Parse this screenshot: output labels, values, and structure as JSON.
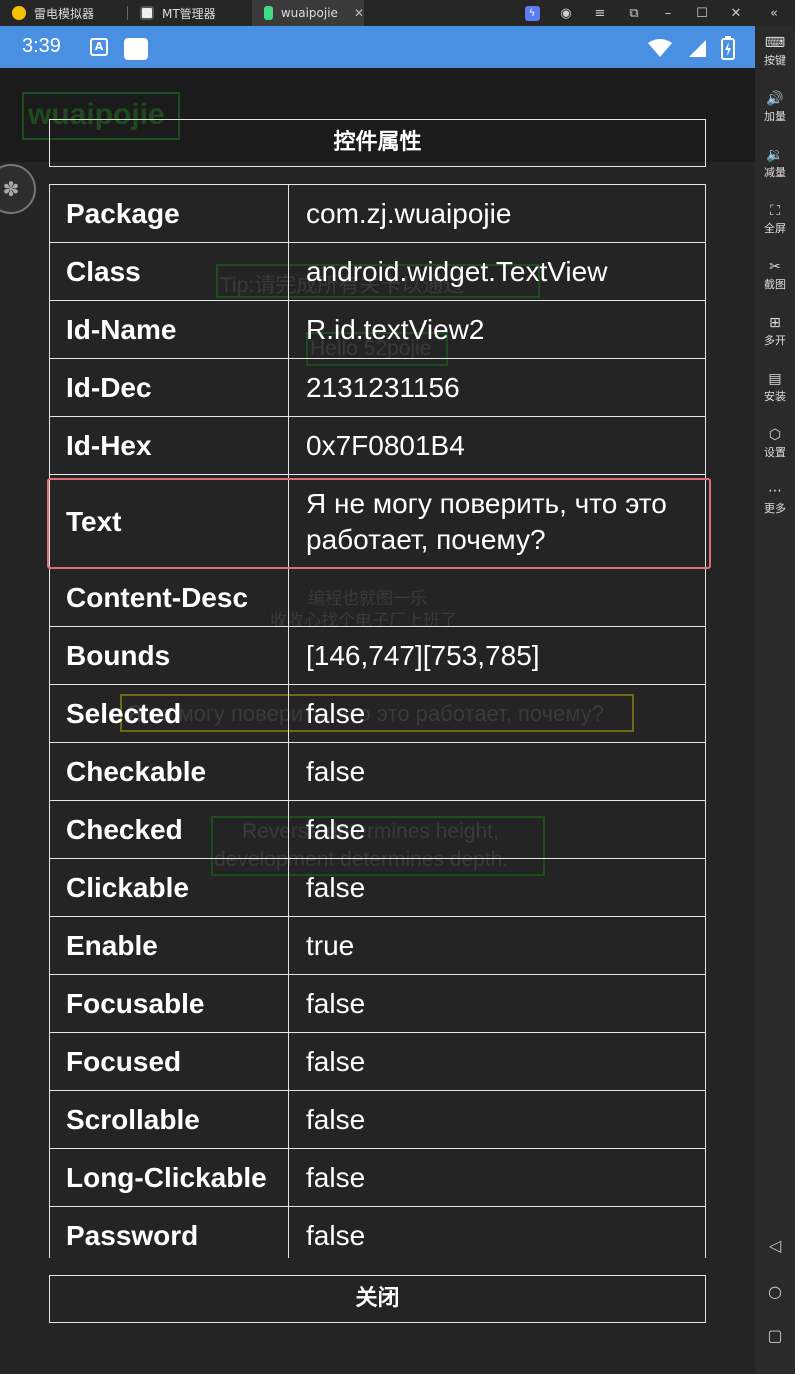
{
  "titlebar": {
    "tabs": [
      {
        "label": "雷电模拟器",
        "icon": "ldplayer-logo-icon"
      },
      {
        "label": "MT管理器",
        "icon": "mt-manager-icon"
      },
      {
        "label": "wuaipojie",
        "icon": "android-app-icon",
        "active": true
      }
    ],
    "close_tab": "✕",
    "window_controls": [
      "bolt-icon",
      "account-icon",
      "menu-icon",
      "popout-icon",
      "minimize-icon",
      "maximize-icon",
      "close-icon",
      "collapse-icon"
    ]
  },
  "sidebar": {
    "items": [
      {
        "label": "按键",
        "icon": "keyboard-icon"
      },
      {
        "label": "加量",
        "icon": "volume-up-icon"
      },
      {
        "label": "减量",
        "icon": "volume-down-icon"
      },
      {
        "label": "全屏",
        "icon": "fullscreen-icon"
      },
      {
        "label": "截图",
        "icon": "scissors-icon"
      },
      {
        "label": "多开",
        "icon": "multi-instance-icon"
      },
      {
        "label": "安装",
        "icon": "apk-install-icon"
      },
      {
        "label": "设置",
        "icon": "settings-icon"
      },
      {
        "label": "更多",
        "icon": "more-icon"
      }
    ],
    "nav": [
      "back-icon",
      "home-icon",
      "recents-icon"
    ]
  },
  "statusbar": {
    "time": "3:39",
    "icons": [
      "wifi-icon",
      "signal-icon",
      "battery-charging-icon"
    ]
  },
  "background_app": {
    "title": "wuaipojie",
    "tip": "Tip:请完成所有关卡以通过",
    "hello": "Hello 52pojie",
    "caption1": "编程也就图一乐",
    "caption2": "收收心找个电子厂上班了",
    "russian": "Я не могу поверить, что это работает, почему?",
    "reverse1": "Reverse determines height,",
    "reverse2": "development determines depth."
  },
  "dialog": {
    "title": "控件属性",
    "close_label": "关闭",
    "rows": [
      {
        "key": "Package",
        "value": "com.zj.wuaipojie"
      },
      {
        "key": "Class",
        "value": "android.widget.TextView"
      },
      {
        "key": "Id-Name",
        "value": "R.id.textView2"
      },
      {
        "key": "Id-Dec",
        "value": "2131231156"
      },
      {
        "key": "Id-Hex",
        "value": "0x7F0801B4"
      },
      {
        "key": "Text",
        "value": "Я не могу поверить, что это работает, почему?"
      },
      {
        "key": "Content-Desc",
        "value": ""
      },
      {
        "key": "Bounds",
        "value": "[146,747][753,785]"
      },
      {
        "key": "Selected",
        "value": "false"
      },
      {
        "key": "Checkable",
        "value": "false"
      },
      {
        "key": "Checked",
        "value": "false"
      },
      {
        "key": "Clickable",
        "value": "false"
      },
      {
        "key": "Enable",
        "value": "true"
      },
      {
        "key": "Focusable",
        "value": "false"
      },
      {
        "key": "Focused",
        "value": "false"
      },
      {
        "key": "Scrollable",
        "value": "false"
      },
      {
        "key": "Long-Clickable",
        "value": "false"
      },
      {
        "key": "Password",
        "value": "false"
      }
    ]
  }
}
